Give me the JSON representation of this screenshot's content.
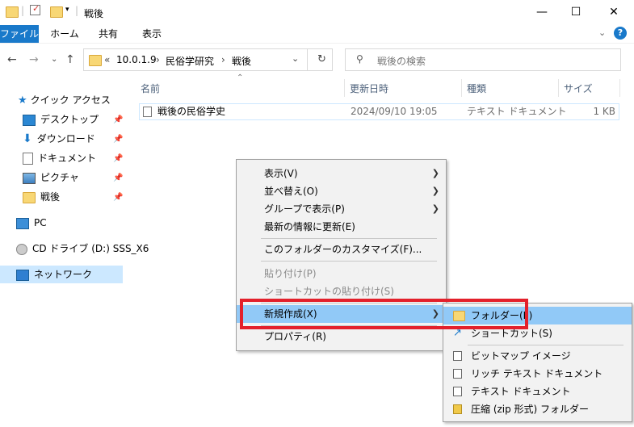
{
  "window": {
    "title": "戦後",
    "minimize": "—",
    "maximize": "☐",
    "close": "✕"
  },
  "ribbon": {
    "tabs": [
      "ファイル",
      "ホーム",
      "共有",
      "表示"
    ],
    "active_color": "#1979ca"
  },
  "address": {
    "crumbs": [
      "«",
      "10.0.1.9",
      "民俗学研究",
      "戦後"
    ],
    "separator": "›",
    "search_placeholder": "戦後の検索"
  },
  "nav": {
    "quick_access": "クイック アクセス",
    "items": [
      {
        "label": "デスクトップ",
        "icon": "desktop-icon",
        "pinned": true
      },
      {
        "label": "ダウンロード",
        "icon": "download-icon",
        "pinned": true
      },
      {
        "label": "ドキュメント",
        "icon": "document-icon",
        "pinned": true
      },
      {
        "label": "ピクチャ",
        "icon": "picture-icon",
        "pinned": true
      },
      {
        "label": "戦後",
        "icon": "folder-icon",
        "pinned": true
      }
    ],
    "pc": "PC",
    "cd_drive": "CD ドライブ (D:) SSS_X6",
    "network": "ネットワーク"
  },
  "columns": {
    "name": "名前",
    "date": "更新日時",
    "type": "種類",
    "size": "サイズ"
  },
  "files": [
    {
      "name": "戦後の民俗学史",
      "date": "2024/09/10 19:05",
      "type": "テキスト ドキュメント",
      "size": "1 KB"
    }
  ],
  "context_menu": {
    "items": [
      {
        "label": "表示(V)",
        "submenu": true,
        "disabled": false
      },
      {
        "label": "並べ替え(O)",
        "submenu": true,
        "disabled": false
      },
      {
        "label": "グループで表示(P)",
        "submenu": true,
        "disabled": false
      },
      {
        "label": "最新の情報に更新(E)",
        "submenu": false,
        "disabled": false
      },
      {
        "label": "このフォルダーのカスタマイズ(F)...",
        "submenu": false,
        "disabled": false
      },
      {
        "label": "貼り付け(P)",
        "submenu": false,
        "disabled": true
      },
      {
        "label": "ショートカットの貼り付け(S)",
        "submenu": false,
        "disabled": true
      },
      {
        "label": "新規作成(X)",
        "submenu": true,
        "disabled": false
      },
      {
        "label": "プロパティ(R)",
        "submenu": false,
        "disabled": false
      }
    ]
  },
  "new_submenu": {
    "items": [
      {
        "label": "フォルダー(F)",
        "icon": "folder-icon"
      },
      {
        "label": "ショートカット(S)",
        "icon": "shortcut-icon"
      },
      {
        "label": "ビットマップ イメージ",
        "icon": "bitmap-icon"
      },
      {
        "label": "リッチ テキスト ドキュメント",
        "icon": "rich-text-icon"
      },
      {
        "label": "テキスト ドキュメント",
        "icon": "text-document-icon"
      },
      {
        "label": "圧縮 (zip 形式) フォルダー",
        "icon": "zip-folder-icon"
      }
    ]
  },
  "highlight_color": "#e3202b"
}
